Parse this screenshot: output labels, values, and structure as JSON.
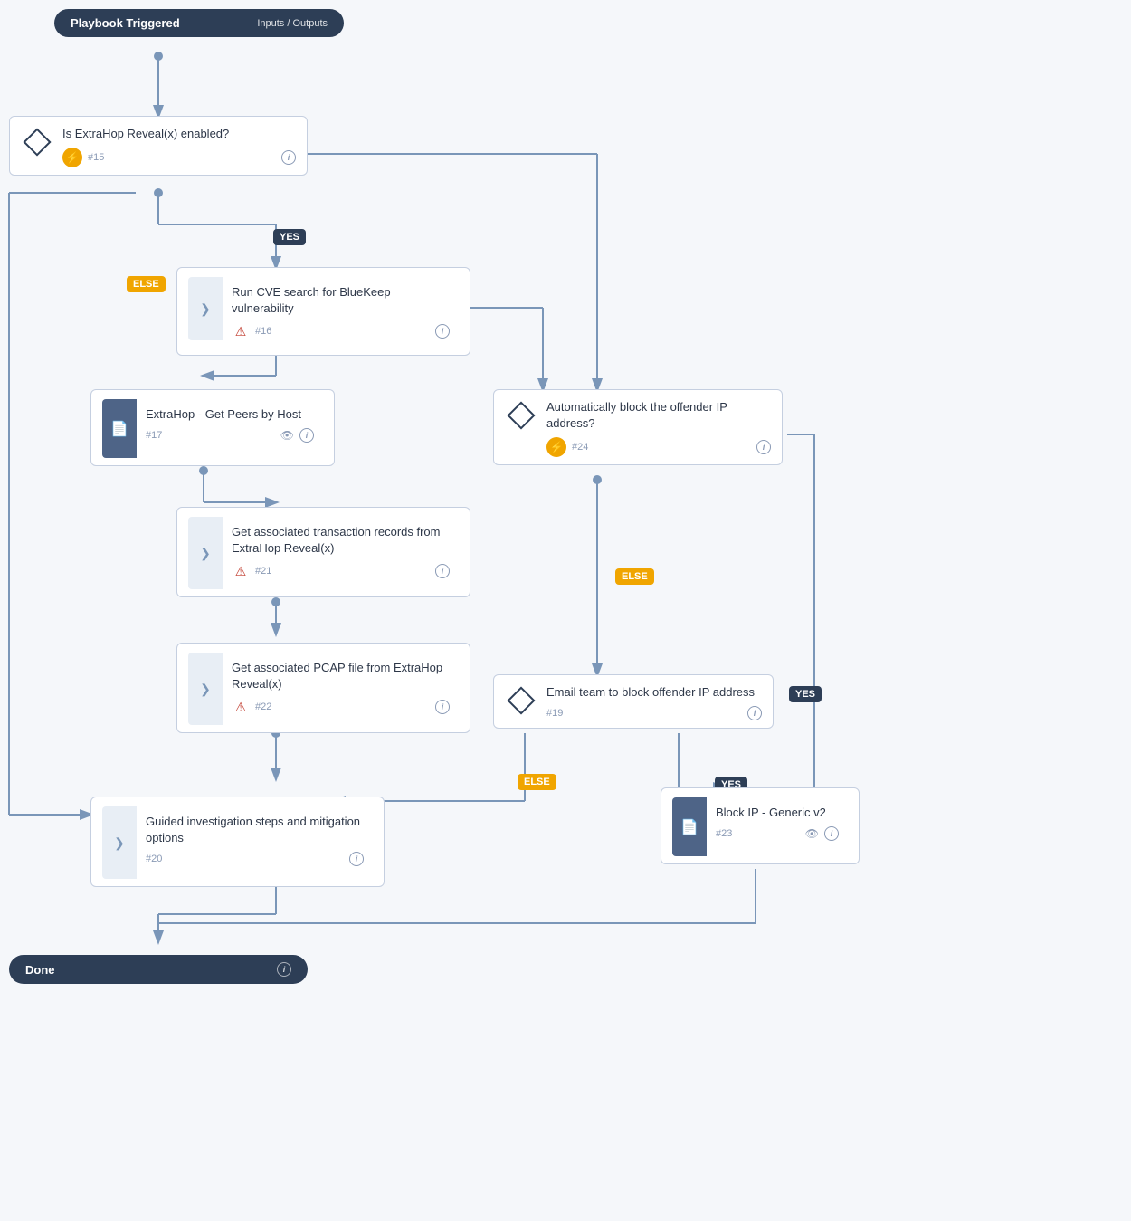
{
  "header": {
    "trigger_label": "Playbook Triggered",
    "inputs_outputs_label": "Inputs / Outputs"
  },
  "done": {
    "label": "Done"
  },
  "nodes": {
    "n15": {
      "id": "#15",
      "title": "Is ExtraHop Reveal(x) enabled?",
      "type": "condition"
    },
    "n16": {
      "id": "#16",
      "title": "Run CVE search for BlueKeep vulnerability",
      "type": "action"
    },
    "n17": {
      "id": "#17",
      "title": "ExtraHop - Get Peers by Host",
      "type": "subplaybook"
    },
    "n21": {
      "id": "#21",
      "title": "Get associated transaction records from ExtraHop Reveal(x)",
      "type": "action"
    },
    "n22": {
      "id": "#22",
      "title": "Get associated PCAP file from ExtraHop Reveal(x)",
      "type": "action"
    },
    "n20": {
      "id": "#20",
      "title": "Guided investigation steps and mitigation options",
      "type": "action"
    },
    "n24": {
      "id": "#24",
      "title": "Automatically block the offender IP address?",
      "type": "condition"
    },
    "n19": {
      "id": "#19",
      "title": "Email team to block offender IP address",
      "type": "condition"
    },
    "n23": {
      "id": "#23",
      "title": "Block IP - Generic v2",
      "type": "subplaybook"
    }
  },
  "badges": {
    "yes1": "YES",
    "yes2": "YES",
    "yes3": "YES",
    "else1": "ELSE",
    "else2": "ELSE",
    "else3": "ELSE"
  },
  "icons": {
    "info": "i",
    "eye": "👁",
    "lightning": "⚡",
    "warning": "⚠",
    "chevron": "❯",
    "document": "📄",
    "diamond": "◆"
  }
}
